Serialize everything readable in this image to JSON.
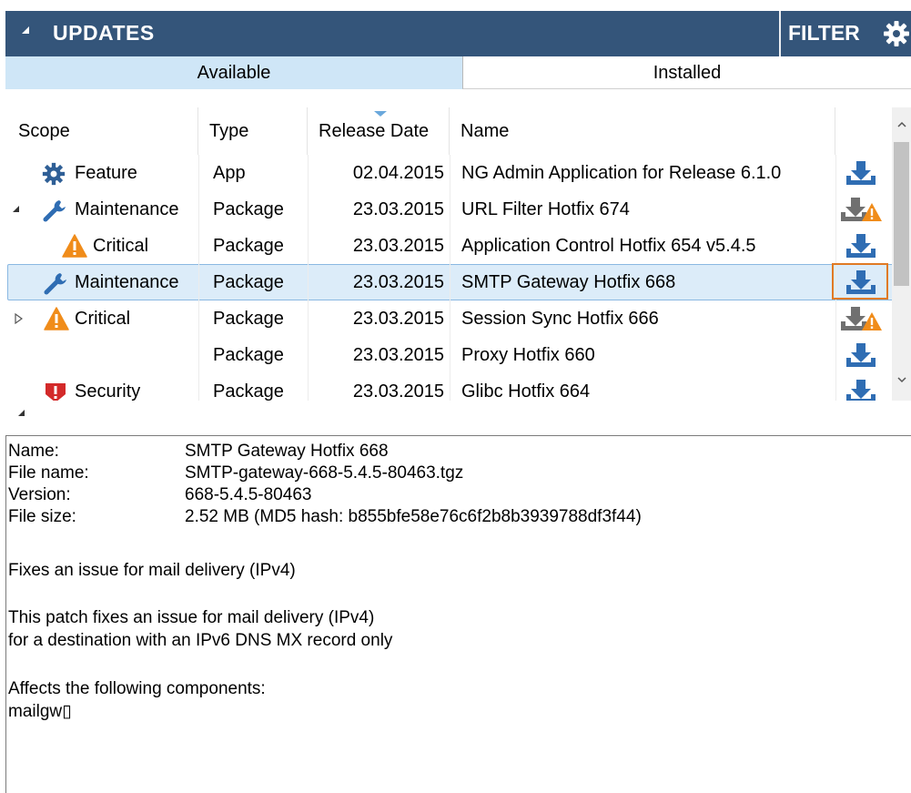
{
  "header": {
    "title": "UPDATES",
    "filter_label": "FILTER",
    "icon": "gear-icon"
  },
  "tabs": [
    {
      "label": "Available",
      "active": true
    },
    {
      "label": "Installed",
      "active": false
    }
  ],
  "grid": {
    "columns": [
      "Scope",
      "Type",
      "Release Date",
      "Name"
    ],
    "sorted_column": "Release Date",
    "rows": [
      {
        "scope": "Feature",
        "scope_icon": "gear-icon",
        "expander": "none",
        "type": "App",
        "date": "02.04.2015",
        "name": "NG Admin Application for Release 6.1.0",
        "action_icon": "download-icon"
      },
      {
        "scope": "Maintenance",
        "scope_icon": "wrench-icon",
        "expander": "expanded",
        "type": "Package",
        "date": "23.03.2015",
        "name": "URL Filter Hotfix 674",
        "action_icon": "download-warning-icon"
      },
      {
        "scope": "Critical",
        "scope_icon": "warning-icon",
        "expander": "none",
        "type": "Package",
        "date": "23.03.2015",
        "name": "Application Control Hotfix 654 v5.4.5",
        "action_icon": "download-icon"
      },
      {
        "scope": "Maintenance",
        "scope_icon": "wrench-icon",
        "expander": "none",
        "type": "Package",
        "date": "23.03.2015",
        "name": "SMTP Gateway Hotfix 668",
        "action_icon": "download-icon",
        "selected": true
      },
      {
        "scope": "Critical",
        "scope_icon": "warning-icon",
        "expander": "collapsed",
        "type": "Package",
        "date": "23.03.2015",
        "name": "Session Sync Hotfix 666",
        "action_icon": "download-warning-icon"
      },
      {
        "scope": "",
        "scope_icon": "",
        "expander": "none",
        "type": "Package",
        "date": "23.03.2015",
        "name": "Proxy Hotfix 660",
        "action_icon": "download-icon"
      },
      {
        "scope": "Security",
        "scope_icon": "shield-icon",
        "expander": "none",
        "type": "Package",
        "date": "23.03.2015",
        "name": "Glibc Hotfix 664",
        "action_icon": "download-icon"
      }
    ]
  },
  "details": {
    "fields": [
      {
        "label": "Name:",
        "value": "SMTP Gateway Hotfix 668"
      },
      {
        "label": "File name:",
        "value": "SMTP-gateway-668-5.4.5-80463.tgz"
      },
      {
        "label": "Version:",
        "value": "668-5.4.5-80463"
      },
      {
        "label": "File size:",
        "value": "2.52 MB  (MD5 hash: b855bfe58e76c6f2b8b3939788df3f44)"
      }
    ],
    "summary": "Fixes an issue for mail delivery (IPv4)",
    "description_line1": "This patch fixes an issue for mail delivery (IPv4)",
    "description_line2": "for a destination with an IPv6 DNS MX record only",
    "components_label": "Affects the following components:",
    "components_value": "mailgw▯"
  },
  "colors": {
    "header_bg": "#34557a",
    "tab_active_bg": "#cfe6f7",
    "selection_bg": "#dcecf9",
    "highlight_border": "#e07a24",
    "download_blue": "#2f6db3",
    "warning_orange": "#f08c1a",
    "security_red": "#d32a2a"
  }
}
